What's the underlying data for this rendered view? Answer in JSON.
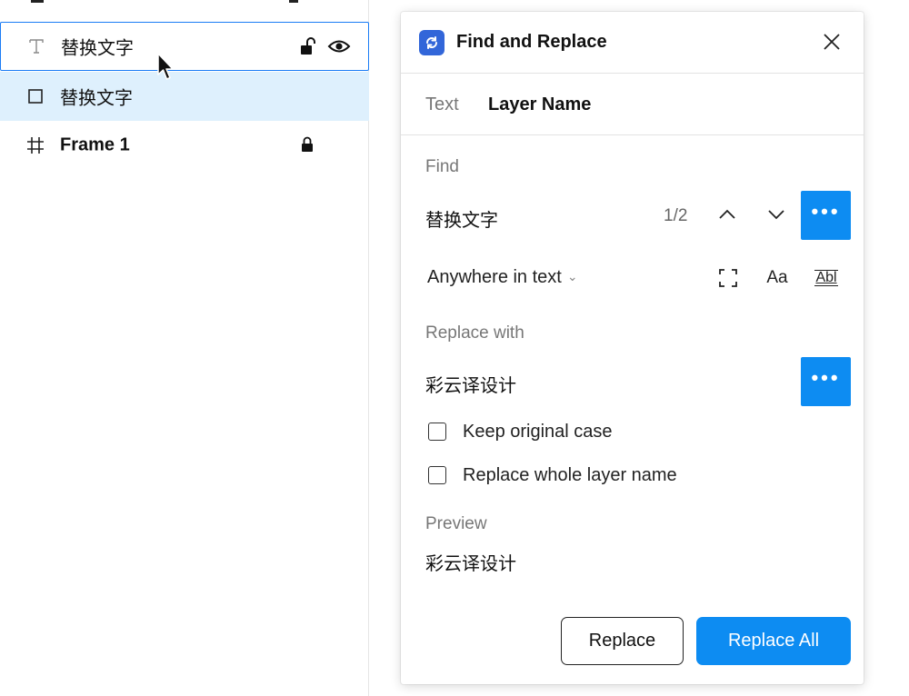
{
  "layers": {
    "items": [
      {
        "icon": "text-layer-icon",
        "label": "替换文字",
        "locked": false,
        "visible_toggle": true
      },
      {
        "icon": "rectangle-layer-icon",
        "label": "替换文字",
        "locked": false,
        "visible_toggle": false
      },
      {
        "icon": "frame-layer-icon",
        "label": "Frame 1",
        "locked": true,
        "visible_toggle": false
      }
    ]
  },
  "dialog": {
    "title": "Find and Replace",
    "tabs": [
      {
        "label": "Text",
        "active": false
      },
      {
        "label": "Layer Name",
        "active": true
      }
    ],
    "find": {
      "label": "Find",
      "value": "替换文字",
      "match_count": "1/2",
      "scope": "Anywhere in text",
      "case_icon_text": "Aa",
      "whole_word_icon_text": "Abl"
    },
    "replace": {
      "label": "Replace with",
      "value": "彩云译设计",
      "keep_case_label": "Keep original case",
      "keep_case_checked": false,
      "whole_name_label": "Replace whole layer name",
      "whole_name_checked": false
    },
    "preview": {
      "label": "Preview",
      "value": "彩云译设计"
    },
    "buttons": {
      "replace": "Replace",
      "replace_all": "Replace All"
    }
  },
  "colors": {
    "accent": "#0d8cf2",
    "selected_row": "#def0fd",
    "hover_outline": "#1a7cf5",
    "app_icon_bg": "#3266d9"
  }
}
